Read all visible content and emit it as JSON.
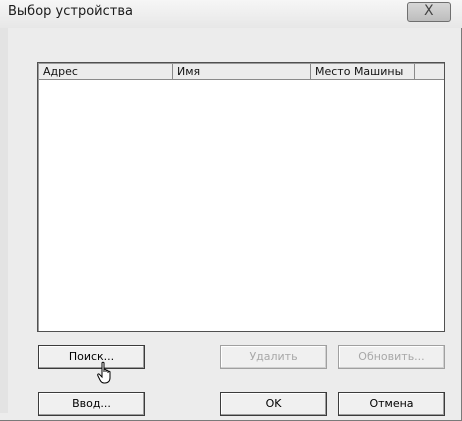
{
  "window": {
    "title": "Выбор устройства",
    "close_glyph": "X"
  },
  "list": {
    "columns": [
      "Адрес",
      "Имя",
      "Место Машины"
    ],
    "rows": []
  },
  "buttons": {
    "search": "Поиск...",
    "delete": "Удалить",
    "refresh": "Обновить...",
    "enter": "Ввод...",
    "ok": "OK",
    "cancel": "Отмена"
  },
  "icons": {
    "close": "close-icon",
    "cursor": "hand-pointer-icon"
  },
  "colors": {
    "window_bg": "#ececec",
    "list_bg": "#ffffff",
    "disabled_text": "#a8a8a8"
  }
}
